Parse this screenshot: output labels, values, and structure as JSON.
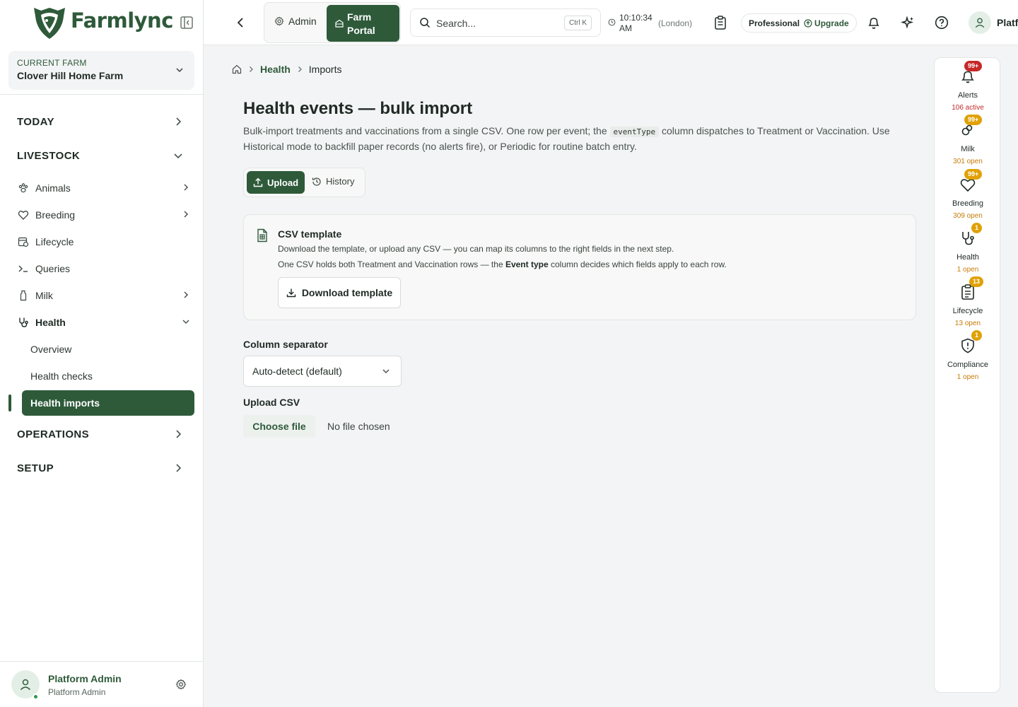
{
  "brand": {
    "name": "Farmlync"
  },
  "farm": {
    "label": "CURRENT FARM",
    "name": "Clover Hill Home Farm"
  },
  "sidebar": {
    "sections": {
      "today": "TODAY",
      "livestock": "LIVESTOCK",
      "operations": "OPERATIONS",
      "setup": "SETUP"
    },
    "items": {
      "animals": "Animals",
      "breeding": "Breeding",
      "lifecycle": "Lifecycle",
      "queries": "Queries",
      "milk": "Milk",
      "health": "Health"
    },
    "health_sub": {
      "overview": "Overview",
      "checks": "Health checks",
      "imports": "Health imports"
    },
    "footer": {
      "name": "Platform Admin",
      "role": "Platform Admin"
    }
  },
  "topbar": {
    "admin_label": "Admin",
    "portal_label_1": "Farm",
    "portal_label_2": "Portal",
    "search_placeholder": "Search...",
    "search_shortcut": "Ctrl K",
    "time_1": "10:10:34",
    "time_2": "AM",
    "timezone": "(London)",
    "plan": "Professional",
    "upgrade": "Upgrade",
    "user_name": "Platf"
  },
  "breadcrumb": {
    "section": "Health",
    "page": "Imports"
  },
  "page": {
    "title": "Health events — bulk import",
    "desc_1": "Bulk-import treatments and vaccinations from a single CSV. One row per event; the ",
    "desc_code": "eventType",
    "desc_2": " column dispatches to Treatment or Vaccination. Use Historical mode to backfill paper records (no alerts fire), or Periodic for routine batch entry."
  },
  "tabs": {
    "upload": "Upload",
    "history": "History"
  },
  "template_card": {
    "title": "CSV template",
    "line1": "Download the template, or upload any CSV — you can map its columns to the right fields in the next step.",
    "line2_a": "One CSV holds both Treatment and Vaccination rows — the ",
    "line2_b": "Event type",
    "line2_c": " column decides which fields apply to each row.",
    "button": "Download template"
  },
  "form": {
    "separator_label": "Column separator",
    "separator_value": "Auto-detect (default)",
    "upload_label": "Upload CSV",
    "choose_file": "Choose file",
    "no_file": "No file chosen"
  },
  "rail": [
    {
      "label": "Alerts",
      "badge": "99+",
      "status": "106 active",
      "color": "#c62828"
    },
    {
      "label": "Milk",
      "badge": "99+",
      "status": "301 open",
      "color": "#e0a106"
    },
    {
      "label": "Breeding",
      "badge": "99+",
      "status": "309 open",
      "color": "#e0a106"
    },
    {
      "label": "Health",
      "badge": "1",
      "status": "1 open",
      "color": "#e0a106"
    },
    {
      "label": "Lifecycle",
      "badge": "13",
      "status": "13 open",
      "color": "#e0a106"
    },
    {
      "label": "Compliance",
      "badge": "1",
      "status": "1 open",
      "color": "#e0a106"
    }
  ],
  "colors": {
    "primary": "#2e5a3a",
    "alert_red": "#c62828",
    "warn_amber": "#e0a106"
  }
}
